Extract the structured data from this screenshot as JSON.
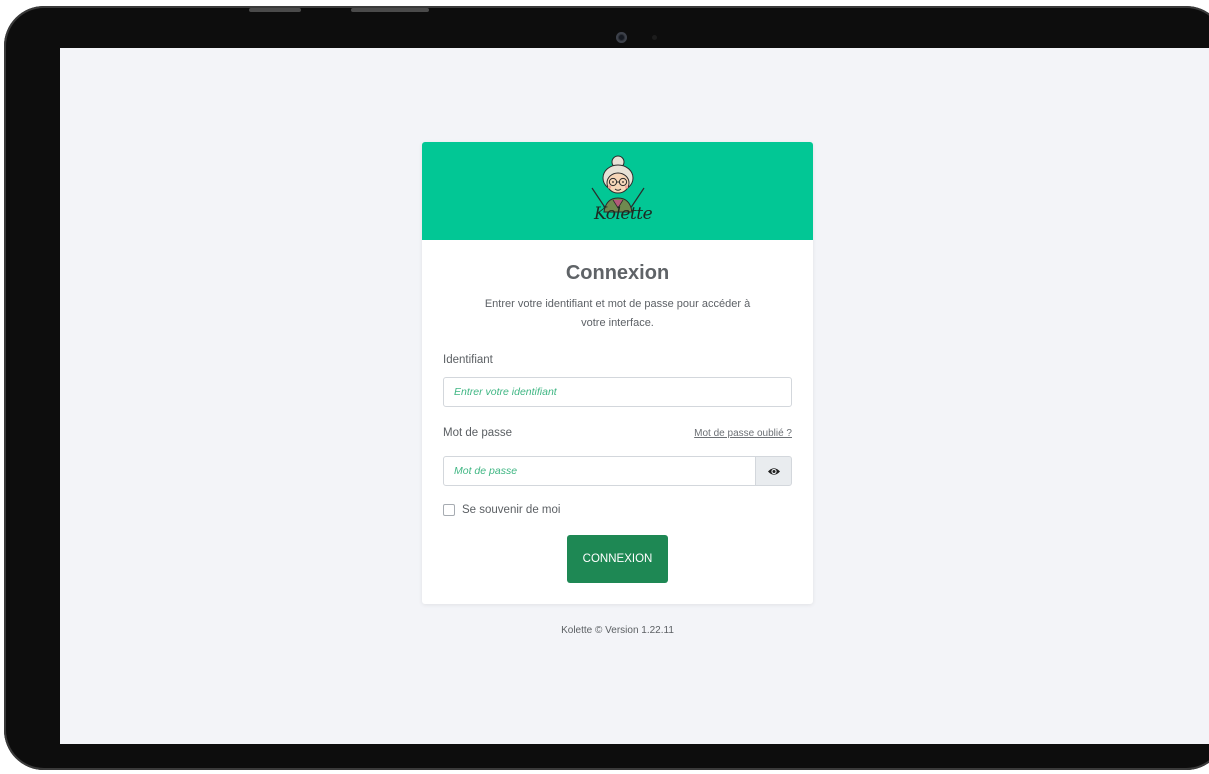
{
  "brand": {
    "logo_text": "Kolette",
    "header_color": "#02c795",
    "button_color": "#1e8854"
  },
  "login": {
    "title": "Connexion",
    "subtitle": "Entrer votre identifiant et mot de passe pour accéder à votre interface.",
    "identifier_label": "Identifiant",
    "identifier_placeholder": "Entrer votre identifiant",
    "password_label": "Mot de passe",
    "forgot_link": "Mot de passe oublié ?",
    "password_placeholder": "Mot de passe",
    "show_password_icon": "eye-icon",
    "remember_label": "Se souvenir de moi",
    "remember_checked": false,
    "submit_label": "CONNEXION"
  },
  "footer": {
    "text": "Kolette © Version 1.22.11"
  }
}
